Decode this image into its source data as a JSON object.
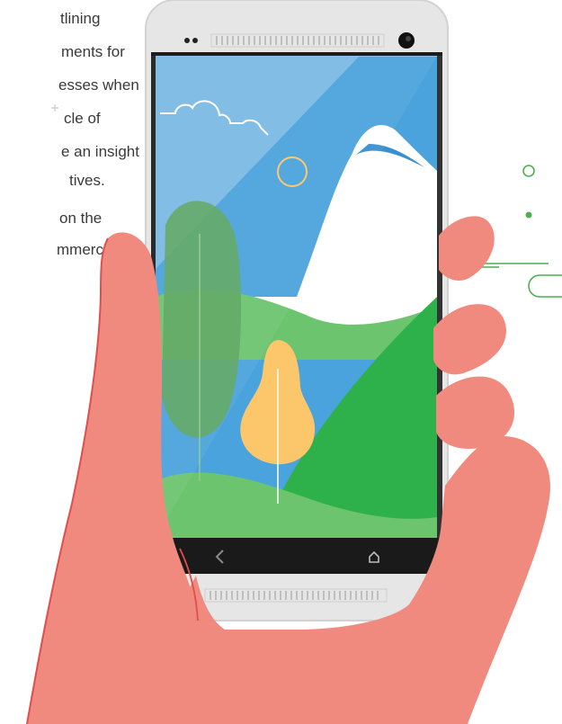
{
  "article": {
    "lines": [
      "tlining",
      "ments for",
      "esses when",
      "cle of",
      "e an insight",
      "tives.",
      "on the",
      "mmerce."
    ]
  },
  "phone": {
    "nav": {
      "back_icon": "back-chevron",
      "home_icon": "home-icon"
    }
  },
  "colors": {
    "hand": "#f08a7e",
    "hand_edge": "#e04e4e",
    "phone_body": "#e8e8e8",
    "phone_dark": "#1e1e1e",
    "sky": "#4aa3dc",
    "sky_light": "#8cc0e8",
    "mountain": "#ffffff",
    "hill_green": "#2eb14b",
    "hill_light": "#6cc46f",
    "tree": "#5da55f",
    "tree_yellow": "#fcc66a",
    "deco_green": "#4caf50"
  }
}
